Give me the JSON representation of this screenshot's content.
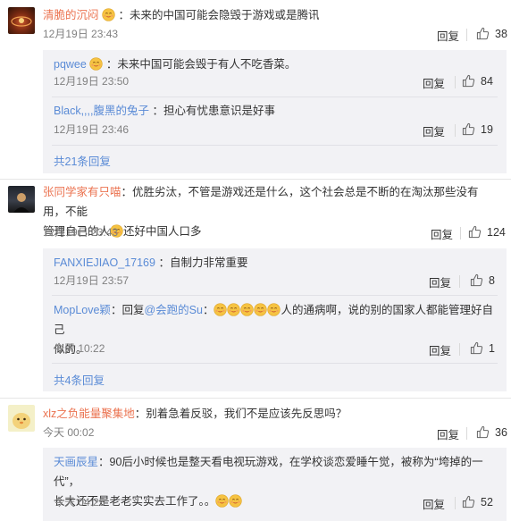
{
  "comments": [
    {
      "name": "清脆的沉闷",
      "text": "：未来的中国可能会隐毁于游戏或是腾讯",
      "time": "12月19日 23:43",
      "reply": "回复",
      "likes": "38",
      "subs": [
        {
          "name": "pqwee",
          "text": "：未来中国可能会毁于有人不吃香菜。",
          "time": "12月19日 23:50",
          "reply": "回复",
          "likes": "84"
        },
        {
          "name": "Black,,,,腹黑的兔子",
          "text": "：担心有忧患意识是好事",
          "time": "12月19日 23:46",
          "reply": "回复",
          "likes": "19"
        }
      ],
      "more": "共21条回复"
    },
    {
      "name": "张同学家有只喵",
      "text1": "：优胜劣汰，不管是游戏还是什么，这个社会总是不断的在淘汰那些没有用，不能",
      "text2a": "管理自己的人",
      "text2b": "还好中国人口多",
      "time": "12月19日 23:43",
      "reply": "回复",
      "likes": "124",
      "subs": [
        {
          "name": "FANXIEJIAO_17169",
          "text": "：自制力非常重要",
          "time": "12月19日 23:57",
          "reply": "回复",
          "likes": "8"
        },
        {
          "name": "MopLove颖",
          "text_a": "：回复",
          "mention": "@会跑的Su",
          "text_b": "：",
          "text_c": "人的通病啊，说的别的国家人都能管理好自己",
          "text_d": "似的。",
          "time": "今天 10:22",
          "reply": "回复",
          "likes": "1"
        }
      ],
      "more": "共4条回复"
    },
    {
      "name": "xlz之负能量聚集地",
      "text": "：别着急着反驳，我们不是应该先反思吗？",
      "time": "今天 00:02",
      "reply": "回复",
      "likes": "36",
      "subs": [
        {
          "name": "天画辰星",
          "text1": "：90后小时候也是整天看电视玩游戏，在学校谈恋爱睡午觉，被称为“垮掉的一代”，",
          "text2": "长大还不是老老实实去工作了。。",
          "time": "今天 04:25",
          "reply": "回复",
          "likes": "52"
        }
      ]
    }
  ],
  "colors": {
    "username": "#eb7350",
    "reply_name": "#5a8bd6",
    "sub_bg": "#f2f2f5"
  },
  "icons": [
    "thumbs-up-icon",
    "emoji-face-icon"
  ]
}
